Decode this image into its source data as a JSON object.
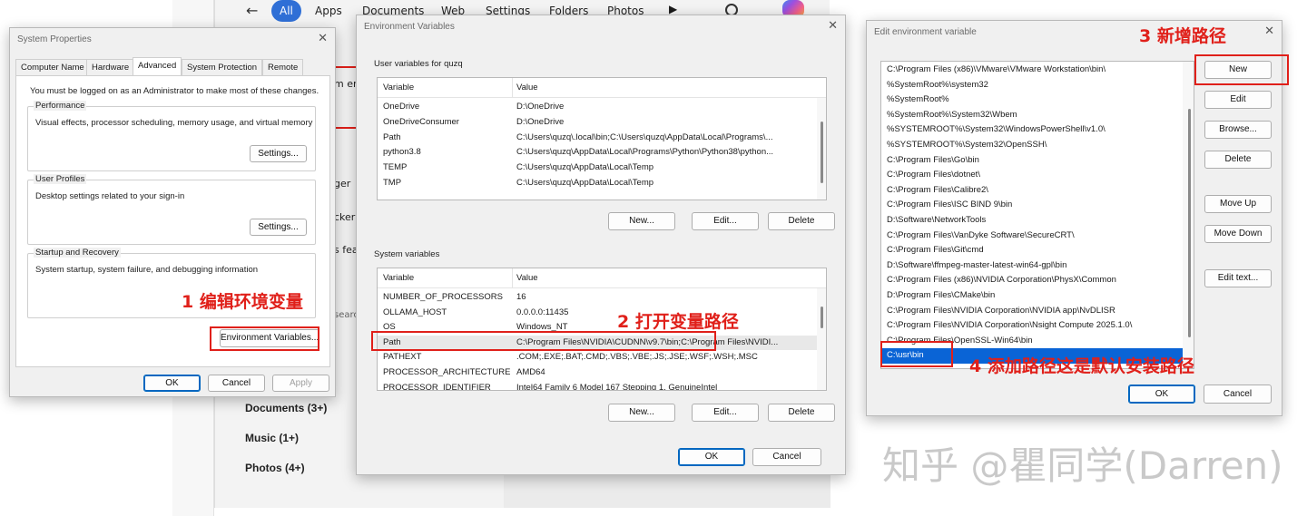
{
  "search": {
    "tabs": [
      "All",
      "Apps",
      "Documents",
      "Web",
      "Settings",
      "Folders",
      "Photos"
    ],
    "fragments": [
      "m en",
      "ger",
      "cker",
      "s fea",
      "searc"
    ],
    "categories": [
      "Documents (3+)",
      "Music (1+)",
      "Photos (4+)"
    ]
  },
  "system_properties": {
    "title": "System Properties",
    "tabs": [
      "Computer Name",
      "Hardware",
      "Advanced",
      "System Protection",
      "Remote"
    ],
    "admin_note": "You must be logged on as an Administrator to make most of these changes.",
    "performance_label": "Performance",
    "performance_desc": "Visual effects, processor scheduling, memory usage, and virtual memory",
    "user_profiles_label": "User Profiles",
    "user_profiles_desc": "Desktop settings related to your sign-in",
    "startup_label": "Startup and Recovery",
    "startup_desc": "System startup, system failure, and debugging information",
    "settings_label": "Settings...",
    "env_vars_label": "Environment Variables...",
    "ok_label": "OK",
    "cancel_label": "Cancel",
    "apply_label": "Apply"
  },
  "env_vars": {
    "title": "Environment Variables",
    "user_group_label": "User variables for quzq",
    "system_group_label": "System variables",
    "col_variable": "Variable",
    "col_value": "Value",
    "user_vars": [
      {
        "name": "OneDrive",
        "value": "D:\\OneDrive"
      },
      {
        "name": "OneDriveConsumer",
        "value": "D:\\OneDrive"
      },
      {
        "name": "Path",
        "value": "C:\\Users\\quzq\\.local\\bin;C:\\Users\\quzq\\AppData\\Local\\Programs\\..."
      },
      {
        "name": "python3.8",
        "value": "C:\\Users\\quzq\\AppData\\Local\\Programs\\Python\\Python38\\python..."
      },
      {
        "name": "TEMP",
        "value": "C:\\Users\\quzq\\AppData\\Local\\Temp"
      },
      {
        "name": "TMP",
        "value": "C:\\Users\\quzq\\AppData\\Local\\Temp"
      }
    ],
    "system_vars": [
      {
        "name": "NUMBER_OF_PROCESSORS",
        "value": "16"
      },
      {
        "name": "OLLAMA_HOST",
        "value": "0.0.0.0:11435"
      },
      {
        "name": "OS",
        "value": "Windows_NT"
      },
      {
        "name": "Path",
        "value": "C:\\Program Files\\NVIDIA\\CUDNN\\v9.7\\bin;C:\\Program Files\\NVIDI..."
      },
      {
        "name": "PATHEXT",
        "value": ".COM;.EXE;.BAT;.CMD;.VBS;.VBE;.JS;.JSE;.WSF;.WSH;.MSC"
      },
      {
        "name": "PROCESSOR_ARCHITECTURE",
        "value": "AMD64"
      },
      {
        "name": "PROCESSOR_IDENTIFIER",
        "value": "Intel64 Family 6 Model 167 Stepping 1, GenuineIntel"
      }
    ],
    "new_label": "New...",
    "edit_label": "Edit...",
    "delete_label": "Delete",
    "ok_label": "OK",
    "cancel_label": "Cancel"
  },
  "edit_env": {
    "title": "Edit environment variable",
    "paths": [
      "C:\\Program Files (x86)\\VMware\\VMware Workstation\\bin\\",
      "%SystemRoot%\\system32",
      "%SystemRoot%",
      "%SystemRoot%\\System32\\Wbem",
      "%SYSTEMROOT%\\System32\\WindowsPowerShell\\v1.0\\",
      "%SYSTEMROOT%\\System32\\OpenSSH\\",
      "C:\\Program Files\\Go\\bin",
      "C:\\Program Files\\dotnet\\",
      "C:\\Program Files\\Calibre2\\",
      "C:\\Program Files\\ISC BIND 9\\bin",
      "D:\\Software\\NetworkTools",
      "C:\\Program Files\\VanDyke Software\\SecureCRT\\",
      "C:\\Program Files\\Git\\cmd",
      "D:\\Software\\ffmpeg-master-latest-win64-gpl\\bin",
      "C:\\Program Files (x86)\\NVIDIA Corporation\\PhysX\\Common",
      "D:\\Program Files\\CMake\\bin",
      "C:\\Program Files\\NVIDIA Corporation\\NVIDIA app\\NvDLISR",
      "C:\\Program Files\\NVIDIA Corporation\\Nsight Compute 2025.1.0\\",
      "C:\\Program Files\\OpenSSL-Win64\\bin",
      "C:\\usr\\bin"
    ],
    "new_label": "New",
    "edit_label": "Edit",
    "browse_label": "Browse...",
    "delete_label": "Delete",
    "move_up_label": "Move Up",
    "move_down_label": "Move Down",
    "edit_text_label": "Edit text...",
    "ok_label": "OK",
    "cancel_label": "Cancel"
  },
  "annotations": {
    "step1": "1 编辑环境变量",
    "step2": "2 打开变量路径",
    "step3": "3 新增路径",
    "step4": "4 添加路径这是默认安装路径"
  },
  "watermark": "知乎 @瞿同学(Darren)",
  "colors": {
    "accent": "#0a64d6",
    "annotation": "#e0201a",
    "tab_pill": "#2f6fd6"
  }
}
